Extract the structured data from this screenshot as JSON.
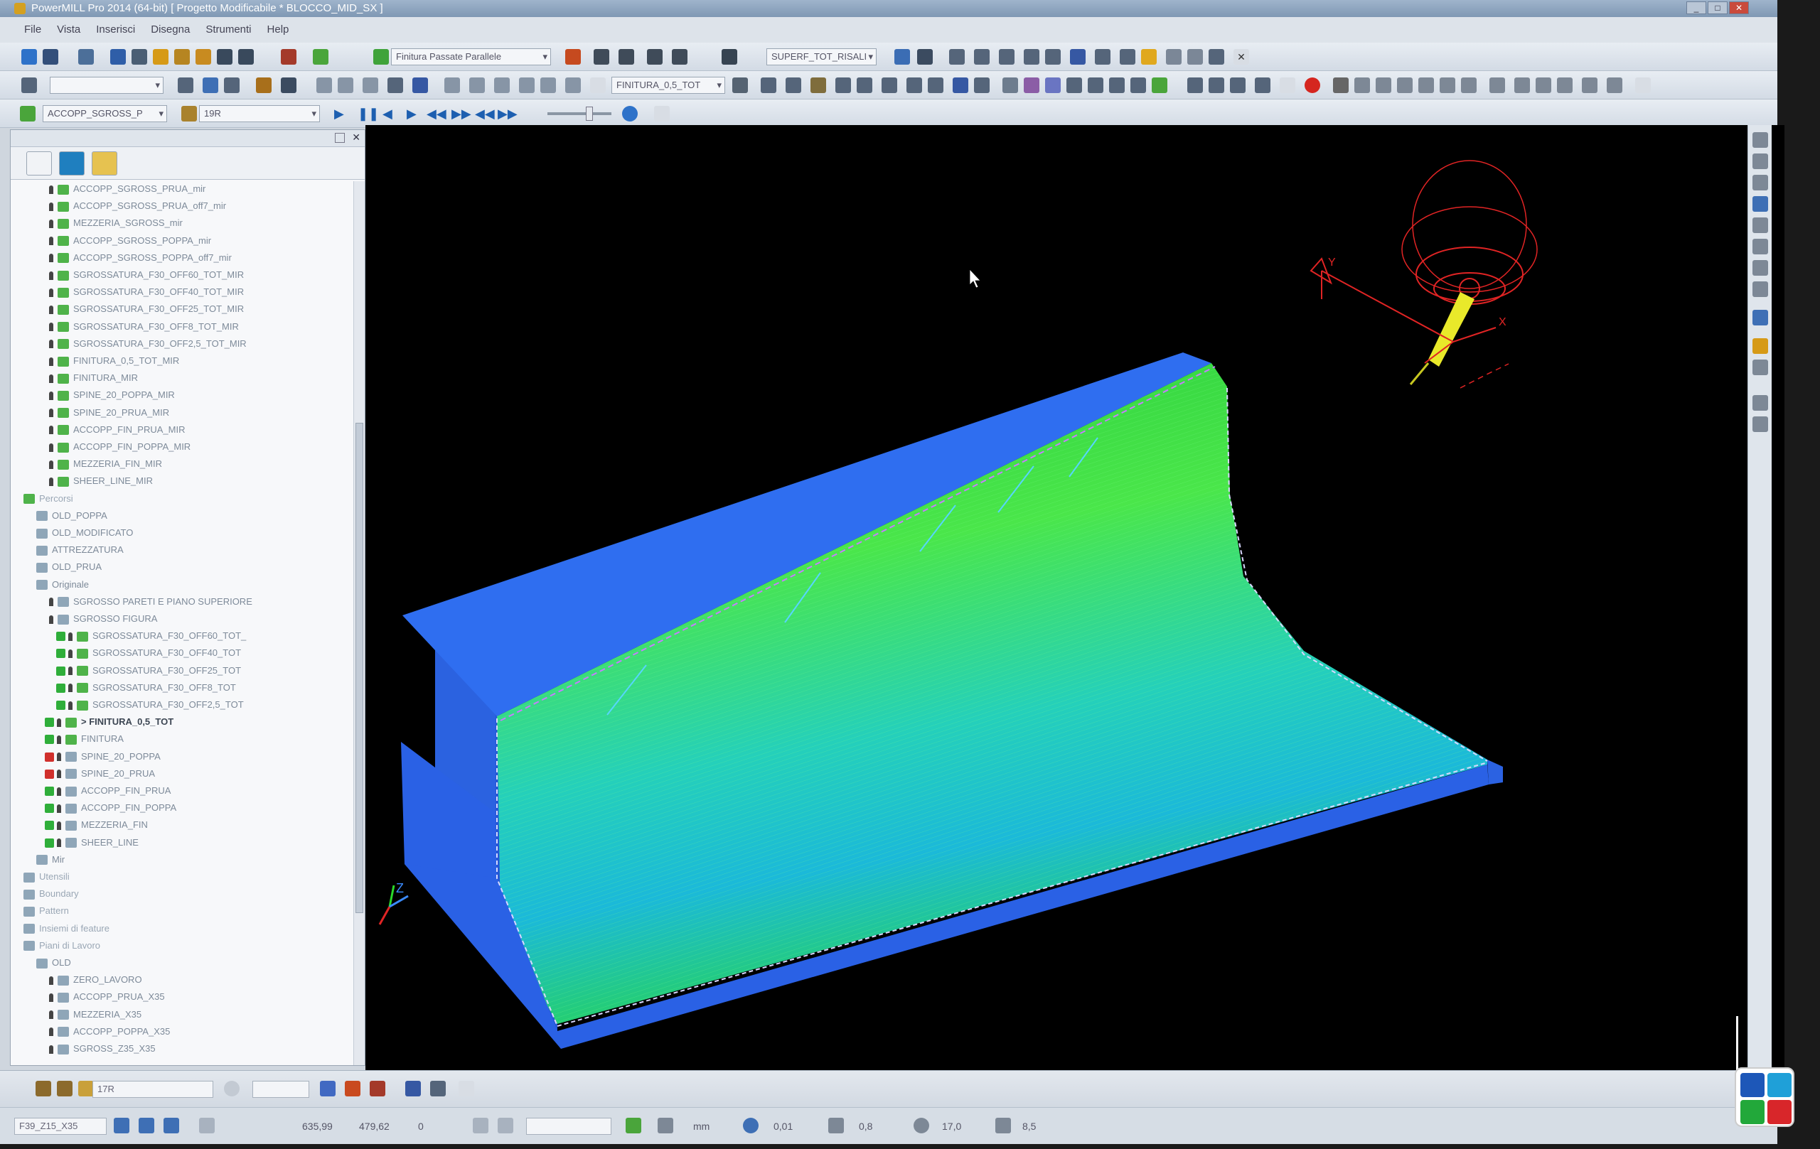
{
  "window": {
    "title": "PowerMILL Pro 2014 (64-bit)    [ Progetto Modificabile * BLOCCO_MID_SX ]",
    "controls": [
      "_",
      "□",
      "✕"
    ]
  },
  "menu": [
    "File",
    "Vista",
    "Inserisci",
    "Disegna",
    "Strumenti",
    "Help"
  ],
  "toolbars": {
    "strategy_combo": "Finitura Passate Parallele",
    "surface_combo": "SUPERF_TOT_RISALI",
    "toolpath_combo": "FINITURA_0,5_TOT",
    "active_toolpath_combo": "ACCOPP_SGROSS_P",
    "tool_combo": "19R",
    "close_label": "✕"
  },
  "explorer": {
    "close_label": "✕",
    "tree": [
      {
        "label": "ACCOPP_SGROSS_PRUA_mir",
        "indent": 2,
        "icon": "green"
      },
      {
        "label": "ACCOPP_SGROSS_PRUA_off7_mir",
        "indent": 2,
        "icon": "green"
      },
      {
        "label": "MEZZERIA_SGROSS_mir",
        "indent": 2,
        "icon": "green"
      },
      {
        "label": "ACCOPP_SGROSS_POPPA_mir",
        "indent": 2,
        "icon": "green"
      },
      {
        "label": "ACCOPP_SGROSS_POPPA_off7_mir",
        "indent": 2,
        "icon": "green"
      },
      {
        "label": "SGROSSATURA_F30_OFF60_TOT_MIR",
        "indent": 2,
        "icon": "green"
      },
      {
        "label": "SGROSSATURA_F30_OFF40_TOT_MIR",
        "indent": 2,
        "icon": "green"
      },
      {
        "label": "SGROSSATURA_F30_OFF25_TOT_MIR",
        "indent": 2,
        "icon": "green"
      },
      {
        "label": "SGROSSATURA_F30_OFF8_TOT_MIR",
        "indent": 2,
        "icon": "green"
      },
      {
        "label": "SGROSSATURA_F30_OFF2,5_TOT_MIR",
        "indent": 2,
        "icon": "green"
      },
      {
        "label": "FINITURA_0,5_TOT_MIR",
        "indent": 2,
        "icon": "green"
      },
      {
        "label": "FINITURA_MIR",
        "indent": 2,
        "icon": "green"
      },
      {
        "label": "SPINE_20_POPPA_MIR",
        "indent": 2,
        "icon": "green"
      },
      {
        "label": "SPINE_20_PRUA_MIR",
        "indent": 2,
        "icon": "green"
      },
      {
        "label": "ACCOPP_FIN_PRUA_MIR",
        "indent": 2,
        "icon": "green"
      },
      {
        "label": "ACCOPP_FIN_POPPA_MIR",
        "indent": 2,
        "icon": "green"
      },
      {
        "label": "MEZZERIA_FIN_MIR",
        "indent": 2,
        "icon": "green"
      },
      {
        "label": "SHEER_LINE_MIR",
        "indent": 2,
        "icon": "green"
      },
      {
        "label": "Percorsi",
        "indent": 0,
        "icon": "green"
      },
      {
        "label": "OLD_POPPA",
        "indent": 1,
        "icon": "grey"
      },
      {
        "label": "OLD_MODIFICATO",
        "indent": 1,
        "icon": "grey"
      },
      {
        "label": "ATTREZZATURA",
        "indent": 1,
        "icon": "grey"
      },
      {
        "label": "OLD_PRUA",
        "indent": 1,
        "icon": "grey"
      },
      {
        "label": "Originale",
        "indent": 1,
        "icon": "grey"
      },
      {
        "label": "SGROSSO PARETI  E PIANO SUPERIORE",
        "indent": 2,
        "icon": "grey"
      },
      {
        "label": "SGROSSO FIGURA",
        "indent": 2,
        "icon": "grey"
      },
      {
        "label": "SGROSSATURA_F30_OFF60_TOT_",
        "indent": 3,
        "icon": "green",
        "check": "green"
      },
      {
        "label": "SGROSSATURA_F30_OFF40_TOT",
        "indent": 3,
        "icon": "green",
        "check": "green"
      },
      {
        "label": "SGROSSATURA_F30_OFF25_TOT",
        "indent": 3,
        "icon": "green",
        "check": "green"
      },
      {
        "label": "SGROSSATURA_F30_OFF8_TOT",
        "indent": 3,
        "icon": "green",
        "check": "green"
      },
      {
        "label": "SGROSSATURA_F30_OFF2,5_TOT",
        "indent": 3,
        "icon": "green",
        "check": "green"
      },
      {
        "label": "> FINITURA_0,5_TOT",
        "indent": 2,
        "icon": "green",
        "check": "green",
        "bold": true
      },
      {
        "label": "FINITURA",
        "indent": 2,
        "icon": "green",
        "check": "green"
      },
      {
        "label": "SPINE_20_POPPA",
        "indent": 2,
        "icon": "grey",
        "check": "red"
      },
      {
        "label": "SPINE_20_PRUA",
        "indent": 2,
        "icon": "grey",
        "check": "red"
      },
      {
        "label": "ACCOPP_FIN_PRUA",
        "indent": 2,
        "icon": "grey",
        "check": "green"
      },
      {
        "label": "ACCOPP_FIN_POPPA",
        "indent": 2,
        "icon": "grey",
        "check": "green"
      },
      {
        "label": "MEZZERIA_FIN",
        "indent": 2,
        "icon": "grey",
        "check": "green"
      },
      {
        "label": "SHEER_LINE",
        "indent": 2,
        "icon": "grey",
        "check": "green"
      },
      {
        "label": "Mir",
        "indent": 1,
        "icon": "grey"
      },
      {
        "label": "Utensili",
        "indent": 0,
        "icon": "grey"
      },
      {
        "label": "Boundary",
        "indent": 0,
        "icon": "grey"
      },
      {
        "label": "Pattern",
        "indent": 0,
        "icon": "grey"
      },
      {
        "label": "Insiemi di feature",
        "indent": 0,
        "icon": "grey"
      },
      {
        "label": "Piani di Lavoro",
        "indent": 0,
        "icon": "grey"
      },
      {
        "label": "OLD",
        "indent": 1,
        "icon": "grey"
      },
      {
        "label": "ZERO_LAVORO",
        "indent": 2,
        "icon": "grey"
      },
      {
        "label": "ACCOPP_PRUA_X35",
        "indent": 2,
        "icon": "grey"
      },
      {
        "label": "MEZZERIA_X35",
        "indent": 2,
        "icon": "grey"
      },
      {
        "label": "ACCOPP_POPPA_X35",
        "indent": 2,
        "icon": "grey"
      },
      {
        "label": "SGROSS_Z35_X35",
        "indent": 2,
        "icon": "grey"
      }
    ]
  },
  "viewport": {
    "axis_labels": {
      "y": "Y",
      "x": "X",
      "z": "Z"
    },
    "colors": {
      "background": "#000000",
      "block": "#2e6be6",
      "surface_green": "#3fe04a",
      "surface_cyan": "#1fc6d6",
      "toolpath": "#ff2a2a"
    }
  },
  "status": {
    "tool_combo": "17R",
    "workplane_combo": "F39_Z15_X35",
    "x_value": "635,99",
    "y_value": "479,62",
    "z_value": "0",
    "units": "mm",
    "tolerance": "0,01",
    "thickness": "0,8",
    "diameter": "17,0",
    "stepover": "8,5"
  }
}
